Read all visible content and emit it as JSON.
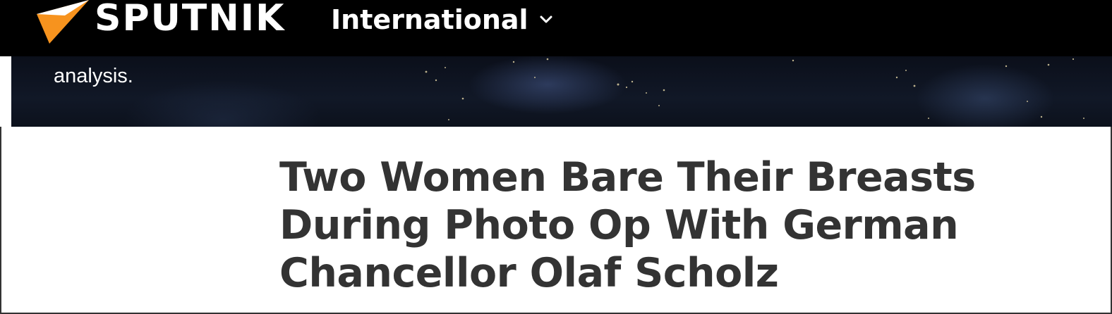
{
  "header": {
    "brand": "SPUTNIK",
    "edition": "International"
  },
  "hero": {
    "text": "analysis."
  },
  "article": {
    "title": "Two Women Bare Their Breasts During Photo Op With German Chancellor Olaf Scholz"
  },
  "colors": {
    "topbar": "#000000",
    "logo_accent": "#f7931e",
    "headline": "#333333"
  }
}
